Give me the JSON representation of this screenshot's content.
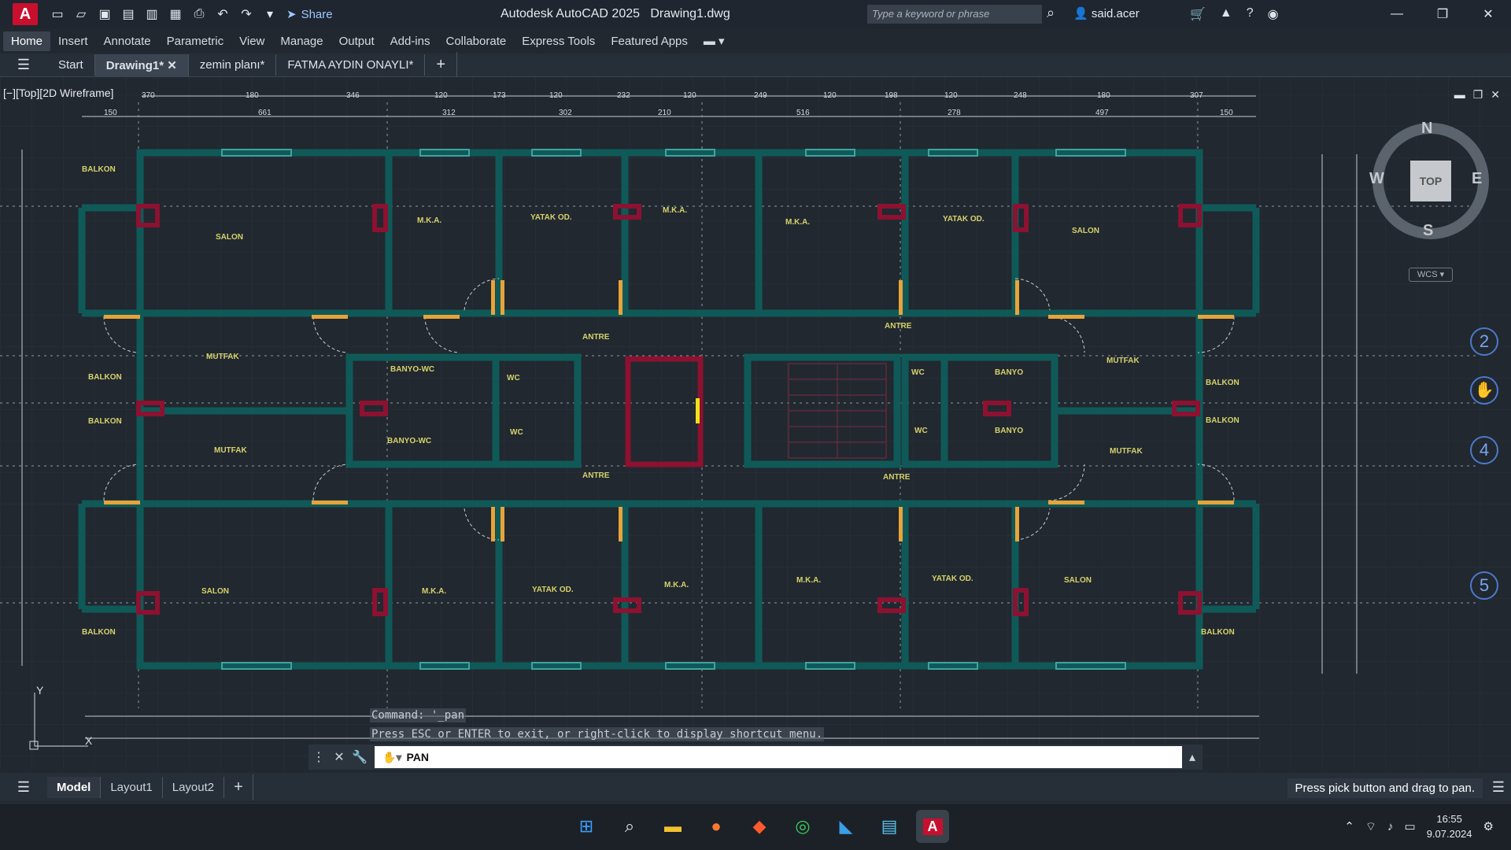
{
  "app": {
    "logo_letter": "A",
    "title": "Autodesk AutoCAD 2025",
    "document": "Drawing1.dwg",
    "share_label": "Share",
    "search_placeholder": "Type a keyword or phrase",
    "user": "said.acer"
  },
  "ribbon_tabs": [
    "Home",
    "Insert",
    "Annotate",
    "Parametric",
    "View",
    "Manage",
    "Output",
    "Add-ins",
    "Collaborate",
    "Express Tools",
    "Featured Apps"
  ],
  "doc_tabs": [
    "Start",
    "Drawing1*",
    "zemin planı*",
    "FATMA AYDIN ONAYLI*"
  ],
  "viewport_label": "[−][Top][2D Wireframe]",
  "viewcube": {
    "n": "N",
    "s": "S",
    "e": "E",
    "w": "W",
    "top": "TOP",
    "wcs": "WCS"
  },
  "nav_markers": [
    "2",
    "4",
    "5"
  ],
  "room_labels": {
    "balkon": "BALKON",
    "salon": "SALON",
    "mka": "M.K.A.",
    "yatak": "YATAK OD.",
    "mutfak": "MUTFAK",
    "antre": "ANTRE",
    "banyo_wc": "BANYO-WC",
    "wc": "WC",
    "banyo": "BANYO"
  },
  "dims_top": [
    "370",
    "180",
    "346",
    "120",
    "173",
    "120",
    "232",
    "120",
    "249",
    "120",
    "198",
    "120",
    "248",
    "180",
    "307"
  ],
  "dims_top2": [
    "150",
    "661",
    "312",
    "302",
    "210",
    "516",
    "278",
    "497",
    "150"
  ],
  "command": {
    "history_1": "Command:  '_pan",
    "history_2": "Press ESC or ENTER to exit, or right-click to display shortcut menu.",
    "input": "PAN"
  },
  "layout_tabs": [
    "Model",
    "Layout1",
    "Layout2"
  ],
  "status_message": "Press pick button and drag to pan.",
  "clock": {
    "time": "16:55",
    "date": "9.07.2024"
  },
  "colors": {
    "wall": "#0f5a58",
    "column": "#8d1130",
    "label": "#d6d26a",
    "door": "#e8a33a"
  }
}
